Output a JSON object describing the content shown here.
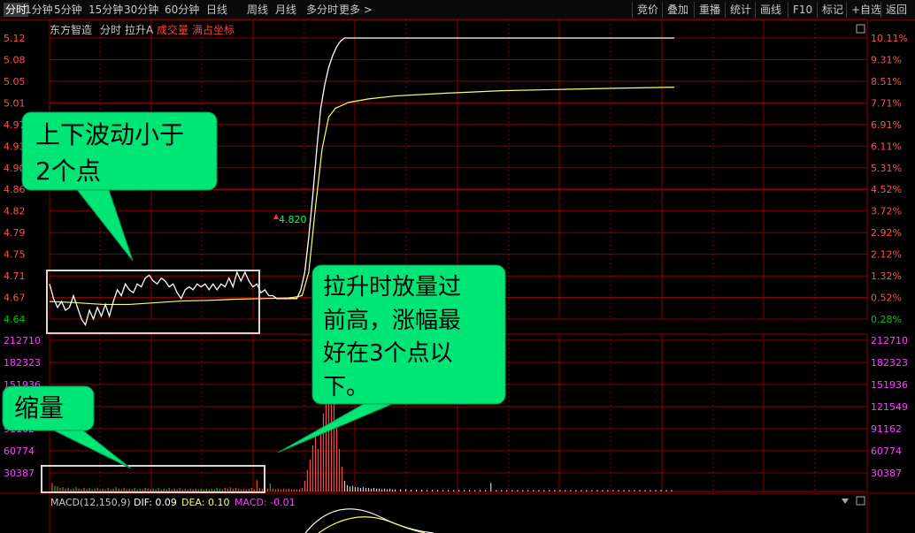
{
  "toolbar": {
    "left_items": [
      {
        "label": "分时",
        "active": true
      },
      {
        "label": "1分钟"
      },
      {
        "label": "5分钟"
      },
      {
        "label": "15分钟"
      },
      {
        "label": "30分钟"
      },
      {
        "label": "60分钟"
      },
      {
        "label": "日线"
      },
      {
        "label": "周线"
      },
      {
        "label": "月线"
      },
      {
        "label": "多分时"
      },
      {
        "label": "更多 >"
      }
    ],
    "right_items": [
      "竞价",
      "叠加",
      "重播",
      "统计",
      "画线",
      "F10",
      "标记",
      "+自选",
      "返回"
    ]
  },
  "chart_header": {
    "stock_name": "东方智造",
    "view": "分时",
    "indicator": "拉升A",
    "volume_label": "成交量",
    "coord_label": "满占坐标"
  },
  "macd_header": {
    "name": "MACD(12,150,9)",
    "dif": "DIF: 0.09",
    "dea": "DEA: 0.10",
    "macd": "MACD: -0.01"
  },
  "price_marker": "4.820",
  "annotations": {
    "box1": "上下波动小于\n2个点",
    "box2": "拉升时放量过\n前高，涨幅最\n好在3个点以\n下。",
    "box3": "缩量"
  },
  "colors": {
    "background": "#000000",
    "grid": "#8b0000",
    "price_line": "#ffffff",
    "avg_line": "#ffff66",
    "up": "#ff4444",
    "down": "#00cc00",
    "volume_axis": "#ff40ff",
    "callout": "#00e676"
  },
  "chart_data": {
    "type": "line",
    "price_axis": {
      "ticks": [
        "5.12",
        "5.08",
        "5.05",
        "5.01",
        "4.97",
        "4.93",
        "4.90",
        "4.86",
        "4.82",
        "4.79",
        "4.75",
        "4.71",
        "4.67",
        "4.64"
      ],
      "pct_ticks": [
        "10.11%",
        "9.31%",
        "8.51%",
        "7.71%",
        "6.91%",
        "6.11%",
        "5.31%",
        "4.52%",
        "3.72%",
        "2.92%",
        "2.12%",
        "1.32%",
        "0.52%",
        "0.28%"
      ],
      "ylim": [
        4.64,
        5.12
      ]
    },
    "volume_axis": {
      "ticks": [
        "212710",
        "182323",
        "151936",
        "121549",
        "91162",
        "60774",
        "30387"
      ]
    },
    "price_series": [
      [
        0,
        4.7
      ],
      [
        3,
        4.675
      ],
      [
        6,
        4.66
      ],
      [
        9,
        4.67
      ],
      [
        12,
        4.655
      ],
      [
        15,
        4.66
      ],
      [
        18,
        4.68
      ],
      [
        21,
        4.66
      ],
      [
        24,
        4.64
      ],
      [
        27,
        4.63
      ],
      [
        30,
        4.655
      ],
      [
        33,
        4.64
      ],
      [
        36,
        4.66
      ],
      [
        39,
        4.645
      ],
      [
        42,
        4.665
      ],
      [
        45,
        4.645
      ],
      [
        48,
        4.67
      ],
      [
        51,
        4.69
      ],
      [
        54,
        4.68
      ],
      [
        57,
        4.7
      ],
      [
        60,
        4.69
      ],
      [
        63,
        4.685
      ],
      [
        66,
        4.7
      ],
      [
        69,
        4.695
      ],
      [
        72,
        4.71
      ],
      [
        75,
        4.715
      ],
      [
        78,
        4.705
      ],
      [
        81,
        4.7
      ],
      [
        84,
        4.71
      ],
      [
        87,
        4.705
      ],
      [
        90,
        4.695
      ],
      [
        93,
        4.7
      ],
      [
        96,
        4.685
      ],
      [
        99,
        4.675
      ],
      [
        102,
        4.69
      ],
      [
        105,
        4.695
      ],
      [
        108,
        4.69
      ],
      [
        111,
        4.7
      ],
      [
        114,
        4.695
      ],
      [
        117,
        4.7
      ],
      [
        120,
        4.69
      ],
      [
        123,
        4.7
      ],
      [
        126,
        4.69
      ],
      [
        129,
        4.7
      ],
      [
        132,
        4.695
      ],
      [
        135,
        4.71
      ],
      [
        138,
        4.695
      ],
      [
        141,
        4.72
      ],
      [
        144,
        4.705
      ],
      [
        147,
        4.72
      ],
      [
        150,
        4.705
      ],
      [
        153,
        4.695
      ],
      [
        156,
        4.7
      ],
      [
        159,
        4.685
      ],
      [
        162,
        4.69
      ],
      [
        165,
        4.68
      ],
      [
        168,
        4.68
      ],
      [
        171,
        4.675
      ],
      [
        174,
        4.675
      ],
      [
        177,
        4.675
      ],
      [
        180,
        4.675
      ],
      [
        183,
        4.675
      ],
      [
        186,
        4.675
      ],
      [
        189,
        4.69
      ],
      [
        192,
        4.72
      ],
      [
        195,
        4.78
      ],
      [
        198,
        4.85
      ],
      [
        201,
        4.93
      ],
      [
        204,
        5.0
      ],
      [
        207,
        5.04
      ],
      [
        210,
        5.07
      ],
      [
        213,
        5.09
      ],
      [
        216,
        5.105
      ],
      [
        219,
        5.115
      ],
      [
        222,
        5.12
      ],
      [
        240,
        5.12
      ],
      [
        280,
        5.12
      ],
      [
        330,
        5.12
      ],
      [
        380,
        5.12
      ],
      [
        420,
        5.12
      ],
      [
        450,
        5.12
      ],
      [
        470,
        5.12
      ]
    ],
    "avg_series": [
      [
        0,
        4.67
      ],
      [
        20,
        4.668
      ],
      [
        40,
        4.665
      ],
      [
        60,
        4.665
      ],
      [
        80,
        4.668
      ],
      [
        100,
        4.671
      ],
      [
        120,
        4.672
      ],
      [
        140,
        4.674
      ],
      [
        160,
        4.675
      ],
      [
        180,
        4.676
      ],
      [
        186,
        4.678
      ],
      [
        190,
        4.68
      ],
      [
        195,
        4.72
      ],
      [
        200,
        4.83
      ],
      [
        205,
        4.93
      ],
      [
        210,
        4.985
      ],
      [
        215,
        5.0
      ],
      [
        225,
        5.01
      ],
      [
        240,
        5.016
      ],
      [
        260,
        5.021
      ],
      [
        300,
        5.026
      ],
      [
        340,
        5.03
      ],
      [
        380,
        5.032
      ],
      [
        420,
        5.034
      ],
      [
        470,
        5.036
      ]
    ],
    "volume_bars": [
      [
        2,
        12000,
        "up"
      ],
      [
        4,
        8000,
        "down"
      ],
      [
        6,
        7000,
        "up"
      ],
      [
        8,
        5000,
        "down"
      ],
      [
        10,
        6000,
        "up"
      ],
      [
        12,
        4000,
        "down"
      ],
      [
        14,
        5000,
        "up"
      ],
      [
        16,
        3000,
        "down"
      ],
      [
        18,
        4000,
        "up"
      ],
      [
        20,
        6000,
        "down"
      ],
      [
        22,
        4000,
        "up"
      ],
      [
        24,
        3000,
        "down"
      ],
      [
        26,
        5000,
        "up"
      ],
      [
        28,
        3000,
        "up"
      ],
      [
        30,
        5000,
        "down"
      ],
      [
        32,
        3000,
        "up"
      ],
      [
        34,
        4000,
        "down"
      ],
      [
        36,
        5000,
        "up"
      ],
      [
        38,
        3000,
        "down"
      ],
      [
        40,
        4000,
        "up"
      ],
      [
        42,
        3000,
        "down"
      ],
      [
        44,
        5000,
        "up"
      ],
      [
        46,
        3000,
        "down"
      ],
      [
        48,
        4000,
        "up"
      ],
      [
        50,
        6000,
        "down"
      ],
      [
        52,
        4000,
        "up"
      ],
      [
        54,
        3000,
        "down"
      ],
      [
        56,
        5000,
        "up"
      ],
      [
        58,
        3000,
        "down"
      ],
      [
        60,
        4000,
        "up"
      ],
      [
        62,
        3000,
        "up"
      ],
      [
        64,
        5000,
        "down"
      ],
      [
        66,
        3000,
        "up"
      ],
      [
        68,
        4000,
        "down"
      ],
      [
        70,
        3000,
        "up"
      ],
      [
        72,
        5000,
        "up"
      ],
      [
        74,
        4000,
        "down"
      ],
      [
        76,
        3000,
        "up"
      ],
      [
        78,
        4000,
        "down"
      ],
      [
        80,
        3000,
        "up"
      ],
      [
        82,
        5000,
        "down"
      ],
      [
        84,
        3000,
        "up"
      ],
      [
        86,
        4000,
        "down"
      ],
      [
        88,
        3000,
        "up"
      ],
      [
        90,
        5000,
        "down"
      ],
      [
        92,
        3000,
        "up"
      ],
      [
        94,
        4000,
        "down"
      ],
      [
        96,
        3000,
        "up"
      ],
      [
        98,
        5000,
        "down"
      ],
      [
        100,
        3000,
        "up"
      ],
      [
        102,
        4000,
        "down"
      ],
      [
        104,
        3000,
        "up"
      ],
      [
        106,
        4000,
        "down"
      ],
      [
        108,
        3000,
        "up"
      ],
      [
        110,
        4000,
        "up"
      ],
      [
        112,
        3000,
        "down"
      ],
      [
        114,
        4000,
        "up"
      ],
      [
        116,
        3000,
        "down"
      ],
      [
        118,
        4000,
        "up"
      ],
      [
        120,
        3000,
        "down"
      ],
      [
        122,
        4000,
        "up"
      ],
      [
        124,
        3000,
        "down"
      ],
      [
        126,
        5000,
        "up"
      ],
      [
        128,
        4000,
        "down"
      ],
      [
        130,
        3000,
        "up"
      ],
      [
        132,
        5000,
        "up"
      ],
      [
        134,
        4000,
        "down"
      ],
      [
        136,
        6000,
        "up"
      ],
      [
        138,
        4000,
        "down"
      ],
      [
        140,
        5000,
        "up"
      ],
      [
        142,
        4000,
        "down"
      ],
      [
        144,
        3000,
        "up"
      ],
      [
        146,
        4000,
        "down"
      ],
      [
        148,
        3000,
        "up"
      ],
      [
        150,
        4000,
        "down"
      ],
      [
        152,
        5000,
        "up"
      ],
      [
        154,
        3000,
        "down"
      ],
      [
        156,
        16000,
        "up"
      ],
      [
        158,
        5000,
        "down"
      ],
      [
        160,
        4000,
        "up"
      ],
      [
        162,
        6000,
        "down"
      ],
      [
        164,
        4000,
        "up"
      ],
      [
        166,
        11000,
        "down"
      ],
      [
        168,
        4000,
        "up"
      ],
      [
        170,
        3000,
        "down"
      ],
      [
        172,
        4000,
        "up"
      ],
      [
        174,
        3000,
        "down"
      ],
      [
        176,
        4000,
        "up"
      ],
      [
        178,
        3000,
        "down"
      ],
      [
        180,
        4000,
        "up"
      ],
      [
        182,
        3000,
        "down"
      ],
      [
        184,
        3000,
        "up"
      ],
      [
        186,
        3000,
        "down"
      ],
      [
        188,
        3000,
        "up"
      ],
      [
        190,
        5000,
        "up"
      ],
      [
        192,
        15000,
        "up"
      ],
      [
        194,
        30000,
        "up"
      ],
      [
        196,
        45000,
        "up"
      ],
      [
        198,
        65000,
        "up"
      ],
      [
        200,
        80000,
        "up"
      ],
      [
        202,
        60000,
        "up"
      ],
      [
        204,
        90000,
        "up"
      ],
      [
        206,
        110000,
        "up"
      ],
      [
        208,
        130000,
        "up"
      ],
      [
        210,
        160000,
        "up"
      ],
      [
        212,
        195000,
        "up"
      ],
      [
        214,
        150000,
        "up"
      ],
      [
        216,
        100000,
        "up"
      ],
      [
        218,
        60000,
        "up"
      ],
      [
        220,
        35000,
        "up"
      ],
      [
        222,
        15000,
        "neutral"
      ],
      [
        224,
        9000,
        "neutral"
      ],
      [
        226,
        7000,
        "neutral"
      ],
      [
        228,
        8000,
        "neutral"
      ],
      [
        230,
        6000,
        "neutral"
      ],
      [
        232,
        6000,
        "neutral"
      ],
      [
        234,
        5000,
        "neutral"
      ],
      [
        236,
        6000,
        "neutral"
      ],
      [
        238,
        5000,
        "neutral"
      ],
      [
        240,
        5000,
        "neutral"
      ],
      [
        242,
        4000,
        "neutral"
      ],
      [
        244,
        5000,
        "neutral"
      ],
      [
        246,
        4000,
        "neutral"
      ],
      [
        248,
        4000,
        "neutral"
      ],
      [
        250,
        3000,
        "neutral"
      ],
      [
        252,
        4000,
        "neutral"
      ],
      [
        254,
        3000,
        "neutral"
      ],
      [
        256,
        4000,
        "neutral"
      ],
      [
        258,
        3000,
        "neutral"
      ],
      [
        260,
        3000,
        "neutral"
      ],
      [
        264,
        3000,
        "neutral"
      ],
      [
        268,
        3000,
        "neutral"
      ],
      [
        272,
        2500,
        "neutral"
      ],
      [
        276,
        2500,
        "neutral"
      ],
      [
        280,
        2500,
        "neutral"
      ],
      [
        284,
        2000,
        "neutral"
      ],
      [
        288,
        2500,
        "neutral"
      ],
      [
        292,
        2000,
        "neutral"
      ],
      [
        296,
        2000,
        "neutral"
      ],
      [
        300,
        2000,
        "neutral"
      ],
      [
        304,
        2000,
        "neutral"
      ],
      [
        308,
        2000,
        "neutral"
      ],
      [
        312,
        2000,
        "neutral"
      ],
      [
        316,
        2000,
        "neutral"
      ],
      [
        320,
        2000,
        "neutral"
      ],
      [
        324,
        2000,
        "neutral"
      ],
      [
        328,
        2000,
        "neutral"
      ],
      [
        332,
        12000,
        "neutral"
      ],
      [
        336,
        2000,
        "neutral"
      ],
      [
        340,
        2000,
        "neutral"
      ],
      [
        344,
        2000,
        "neutral"
      ],
      [
        348,
        2000,
        "neutral"
      ],
      [
        352,
        2000,
        "neutral"
      ],
      [
        356,
        2000,
        "neutral"
      ],
      [
        360,
        2000,
        "neutral"
      ],
      [
        364,
        2000,
        "neutral"
      ],
      [
        368,
        2000,
        "neutral"
      ],
      [
        372,
        2000,
        "neutral"
      ],
      [
        376,
        2000,
        "neutral"
      ],
      [
        380,
        2000,
        "neutral"
      ],
      [
        384,
        2000,
        "neutral"
      ],
      [
        388,
        2000,
        "neutral"
      ],
      [
        392,
        2000,
        "neutral"
      ],
      [
        396,
        2000,
        "neutral"
      ],
      [
        400,
        2000,
        "neutral"
      ],
      [
        404,
        2000,
        "neutral"
      ],
      [
        408,
        2000,
        "neutral"
      ],
      [
        412,
        2000,
        "neutral"
      ],
      [
        416,
        2000,
        "neutral"
      ],
      [
        420,
        2000,
        "neutral"
      ],
      [
        424,
        2000,
        "neutral"
      ],
      [
        428,
        2000,
        "neutral"
      ],
      [
        432,
        2000,
        "neutral"
      ],
      [
        436,
        2000,
        "neutral"
      ],
      [
        440,
        2000,
        "neutral"
      ],
      [
        444,
        2000,
        "neutral"
      ],
      [
        448,
        2000,
        "neutral"
      ],
      [
        452,
        2000,
        "neutral"
      ],
      [
        456,
        2000,
        "neutral"
      ],
      [
        460,
        2000,
        "neutral"
      ],
      [
        464,
        2000,
        "neutral"
      ],
      [
        468,
        2000,
        "neutral"
      ]
    ]
  }
}
